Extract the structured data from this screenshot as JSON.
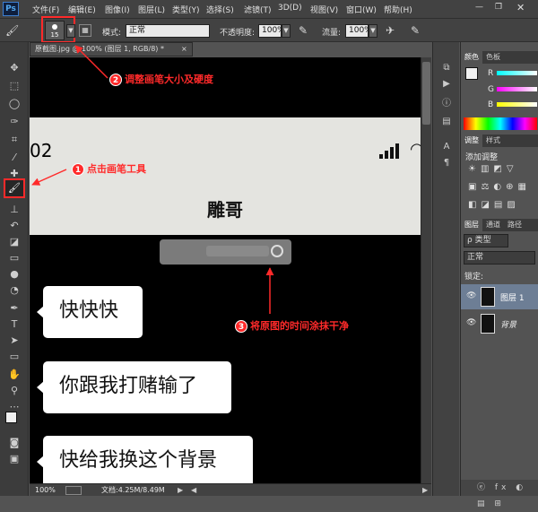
{
  "menu": [
    "文件(F)",
    "编辑(E)",
    "图像(I)",
    "图层(L)",
    "类型(Y)",
    "选择(S)",
    "滤镜(T)",
    "3D(D)",
    "视图(V)",
    "窗口(W)",
    "帮助(H)"
  ],
  "ps_logo": "Ps",
  "options": {
    "brush_size": "15",
    "mode_label": "模式:",
    "mode_value": "正常",
    "opacity_label": "不透明度:",
    "opacity_value": "100%",
    "flow_label": "流量:",
    "flow_value": "100%"
  },
  "document": {
    "tab_title": "原截图.jpg @ 100% (图层 1, RGB/8) *",
    "zoom": "100%",
    "doc_info": "文档:4.25M/8.49M"
  },
  "phone": {
    "time_partial": "02",
    "title": "雕哥",
    "messages": [
      "快快快",
      "你跟我打赌输了",
      "快给我换这个背景"
    ]
  },
  "annotations": {
    "step1": {
      "num": "1",
      "text": "点击画笔工具"
    },
    "step2": {
      "num": "2",
      "text": "调整画笔大小及硬度"
    },
    "step3": {
      "num": "3",
      "text": "将原图的时间涂抹干净"
    },
    "color": "#ff2a2a"
  },
  "panels": {
    "color_tabs": [
      "颜色",
      "色板"
    ],
    "channels": [
      "R",
      "G",
      "B"
    ],
    "adjust_tabs": [
      "调整",
      "样式"
    ],
    "adjust_title": "添加调整",
    "layer_tabs": [
      "图层",
      "通道",
      "路径"
    ],
    "filter_label": "ρ 类型",
    "blend_mode": "正常",
    "lock_label": "锁定:",
    "layers": [
      "图层 1",
      "背景"
    ]
  }
}
